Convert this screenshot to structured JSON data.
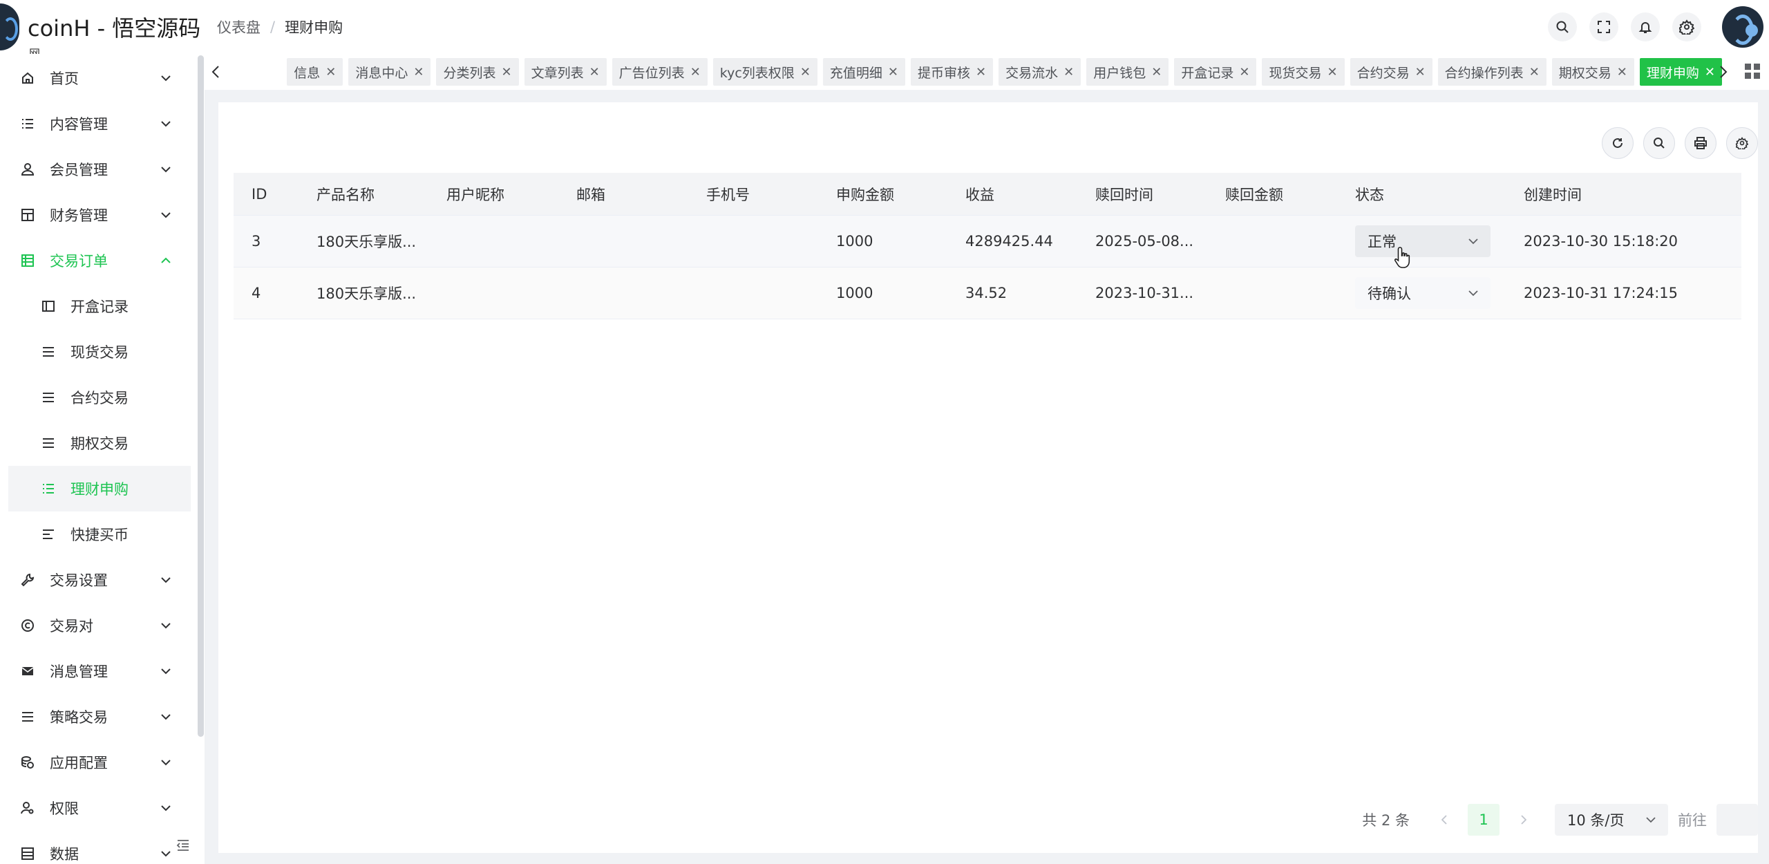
{
  "app": {
    "title": "coinH - 悟空源码",
    "subtitle": "网"
  },
  "breadcrumb": {
    "home": "仪表盘",
    "separator": "/",
    "current": "理财申购"
  },
  "sidebar": {
    "items": [
      {
        "label": "首页",
        "icon": "home-icon"
      },
      {
        "label": "内容管理",
        "icon": "list-icon"
      },
      {
        "label": "会员管理",
        "icon": "user-icon"
      },
      {
        "label": "财务管理",
        "icon": "grid-icon"
      },
      {
        "label": "交易订单",
        "icon": "table-icon",
        "expanded": true
      },
      {
        "label": "交易设置",
        "icon": "wrench-icon"
      },
      {
        "label": "交易对",
        "icon": "copyright-icon"
      },
      {
        "label": "消息管理",
        "icon": "mail-icon"
      },
      {
        "label": "策略交易",
        "icon": "menu-icon"
      },
      {
        "label": "应用配置",
        "icon": "coins-icon"
      },
      {
        "label": "权限",
        "icon": "user-key-icon"
      },
      {
        "label": "数据",
        "icon": "database-icon"
      }
    ],
    "subitems": [
      {
        "label": "开盒记录",
        "icon": "panel-icon"
      },
      {
        "label": "现货交易",
        "icon": "lines-icon"
      },
      {
        "label": "合约交易",
        "icon": "lines-icon"
      },
      {
        "label": "期权交易",
        "icon": "lines-icon"
      },
      {
        "label": "理财申购",
        "icon": "list-icon",
        "active": true
      },
      {
        "label": "快捷买币",
        "icon": "align-left-icon"
      }
    ]
  },
  "tags": [
    {
      "label": "信息"
    },
    {
      "label": "消息中心"
    },
    {
      "label": "分类列表"
    },
    {
      "label": "文章列表"
    },
    {
      "label": "广告位列表"
    },
    {
      "label": "kyc列表权限"
    },
    {
      "label": "充值明细"
    },
    {
      "label": "提币审核"
    },
    {
      "label": "交易流水"
    },
    {
      "label": "用户钱包"
    },
    {
      "label": "开盒记录"
    },
    {
      "label": "现货交易"
    },
    {
      "label": "合约交易"
    },
    {
      "label": "合约操作列表"
    },
    {
      "label": "期权交易"
    },
    {
      "label": "理财申购",
      "active": true
    }
  ],
  "colors": {
    "accent": "#1ec452",
    "active_tag": "#21c248"
  },
  "table": {
    "headers": [
      "ID",
      "产品名称",
      "用户昵称",
      "邮箱",
      "手机号",
      "申购金额",
      "收益",
      "赎回时间",
      "赎回金额",
      "状态",
      "创建时间"
    ],
    "rows": [
      {
        "id": "3",
        "product": "180天乐享版...",
        "nickname": "",
        "email": "",
        "phone": "",
        "amount": "1000",
        "profit": "4289425.44",
        "redeem_time": "2025-05-08...",
        "redeem_amount": "",
        "status": "正常",
        "created": "2023-10-30 15:18:20"
      },
      {
        "id": "4",
        "product": "180天乐享版...",
        "nickname": "",
        "email": "",
        "phone": "",
        "amount": "1000",
        "profit": "34.52",
        "redeem_time": "2023-10-31...",
        "redeem_amount": "",
        "status": "待确认",
        "created": "2023-10-31 17:24:15"
      }
    ]
  },
  "pagination": {
    "total": "共 2 条",
    "current": "1",
    "page_size": "10 条/页",
    "goto": "前往"
  }
}
